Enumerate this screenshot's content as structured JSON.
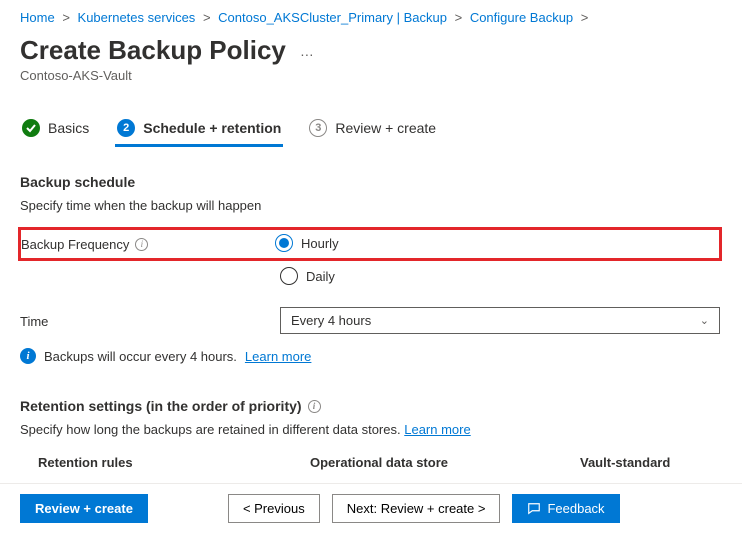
{
  "breadcrumb": {
    "items": [
      "Home",
      "Kubernetes services",
      "Contoso_AKSCluster_Primary | Backup",
      "Configure Backup"
    ]
  },
  "page": {
    "title": "Create Backup Policy",
    "subtitle": "Contoso-AKS-Vault",
    "more": "…"
  },
  "tabs": {
    "items": [
      {
        "num": "✓",
        "label": "Basics",
        "state": "done"
      },
      {
        "num": "2",
        "label": "Schedule + retention",
        "state": "active"
      },
      {
        "num": "3",
        "label": "Review + create",
        "state": "pending"
      }
    ]
  },
  "schedule": {
    "heading": "Backup schedule",
    "desc": "Specify time when the backup will happen",
    "freq_label": "Backup Frequency",
    "freq_options": {
      "hourly": "Hourly",
      "daily": "Daily"
    },
    "freq_selected": "hourly",
    "time_label": "Time",
    "time_value": "Every 4 hours",
    "info_text": "Backups will occur every 4 hours.",
    "learn_more": "Learn more"
  },
  "retention": {
    "heading": "Retention settings (in the order of priority)",
    "desc": "Specify how long the backups are retained in different data stores.",
    "learn_more": "Learn more",
    "cols": {
      "rules": "Retention rules",
      "ops": "Operational data store",
      "vault": "Vault-standard"
    }
  },
  "footer": {
    "review": "Review + create",
    "prev": "<  Previous",
    "next": "Next: Review + create  >",
    "feedback": "Feedback"
  }
}
